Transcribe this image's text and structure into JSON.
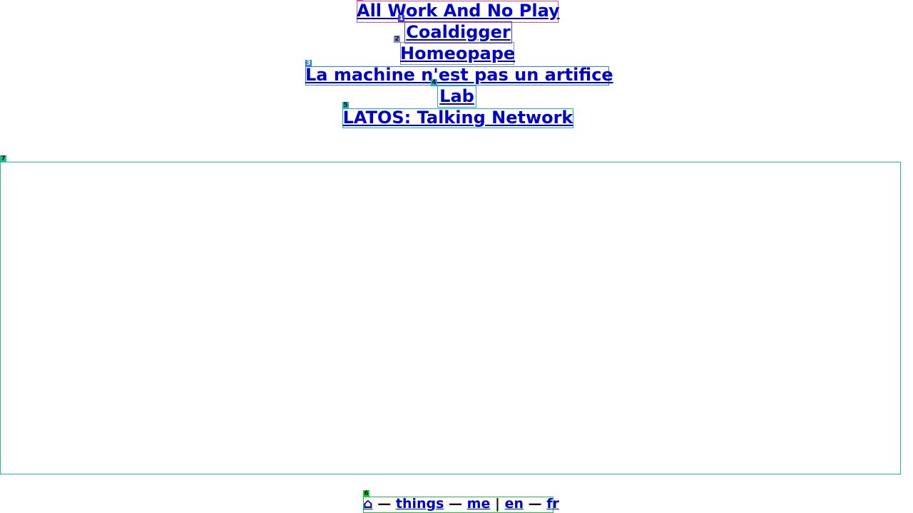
{
  "projects": [
    {
      "label": "All Work And No Play",
      "badge": "0",
      "color": "#e6449b"
    },
    {
      "label": "Coaldigger",
      "badge": "1",
      "color": "#3b3bdc"
    },
    {
      "label": "Homeopape",
      "badge": "2",
      "color": "#7f86c9"
    },
    {
      "label": "La machine n'est pas un artifice",
      "badge": "3",
      "color": "#2f7cf0"
    },
    {
      "label": "Lab",
      "badge": "4",
      "color": "#27a8d6"
    },
    {
      "label": "LATOS: Talking Network",
      "badge": "5",
      "color": "#16b6b0"
    }
  ],
  "footer": {
    "badge": "6",
    "color": "#19c93a",
    "home": "⌂",
    "things": "things",
    "me": "me",
    "en": "en",
    "fr": "fr",
    "dash": "—",
    "pipe": "|"
  },
  "frame": {
    "badge": "7",
    "color": "#1fc08a"
  }
}
